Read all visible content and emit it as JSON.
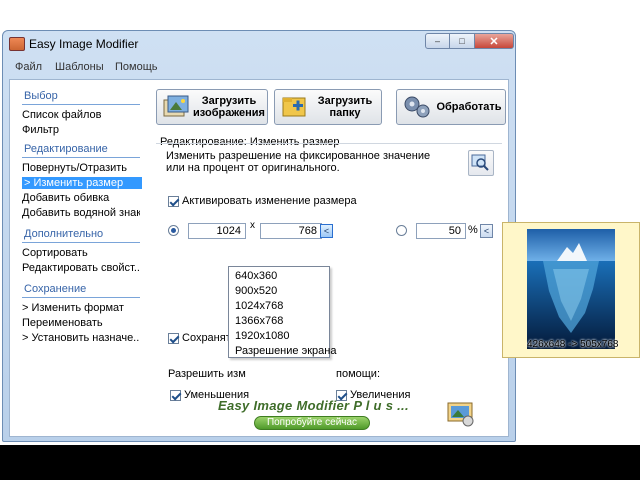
{
  "app": {
    "title": "Easy Image Modifier",
    "window_controls": {
      "minimize": "–",
      "maximize": "□",
      "close": "✕"
    }
  },
  "menu": [
    "Файл",
    "Шаблоны",
    "Помощь"
  ],
  "sidebar": {
    "sections": [
      {
        "heading": "Выбор",
        "items": [
          "Список файлов",
          "Фильтр"
        ]
      },
      {
        "heading": "Редактирование",
        "items": [
          "Повернуть/Отразить",
          "> Изменить размер",
          "Добавить обивка",
          "Добавить водяной знак"
        ]
      },
      {
        "heading": "Дополнительно",
        "items": [
          "Сортировать",
          "Редактировать свойст..."
        ]
      },
      {
        "heading": "Сохранение",
        "items": [
          "> Изменить формат",
          "Переименовать",
          "> Установить назначе..."
        ]
      }
    ],
    "selected": "> Изменить размер"
  },
  "toolbar": {
    "load_images": "Загрузить изображения",
    "load_images_line1": "Загрузить",
    "load_images_line2": "изображения",
    "load_folder_line1": "Загрузить",
    "load_folder_line2": "папку",
    "process": "Обработать"
  },
  "panel": {
    "group_title": "Редактирование: Изменить размер",
    "description": "Изменить разрешение на фиксированное значение или на процент от оригинального.",
    "activate_resize": "Активировать изменение размера",
    "activate_checked": true,
    "width": "1024",
    "x_sep": "x",
    "height": "768",
    "percent": "50",
    "percent_sign": "%",
    "keep_label": "Сохранять п",
    "allow_label": "Разрешить изм",
    "allow_label_tail": "помощи:",
    "shrink": "Уменьшения",
    "enlarge": "Увеличения",
    "arrow": "<"
  },
  "dropdown": {
    "options": [
      "640x360",
      "900x520",
      "1024x768",
      "1366x768",
      "1920x1080",
      "Разрешение экрана"
    ]
  },
  "promo": {
    "text": "Easy Image Modifier P l u s  ...",
    "button": "Попробуйте сейчас"
  },
  "preview": {
    "caption": "426x648 -> 505x768"
  },
  "colors": {
    "accent": "#3399ff",
    "section_heading": "#3764a8",
    "promo_green": "#3f6d2a"
  }
}
